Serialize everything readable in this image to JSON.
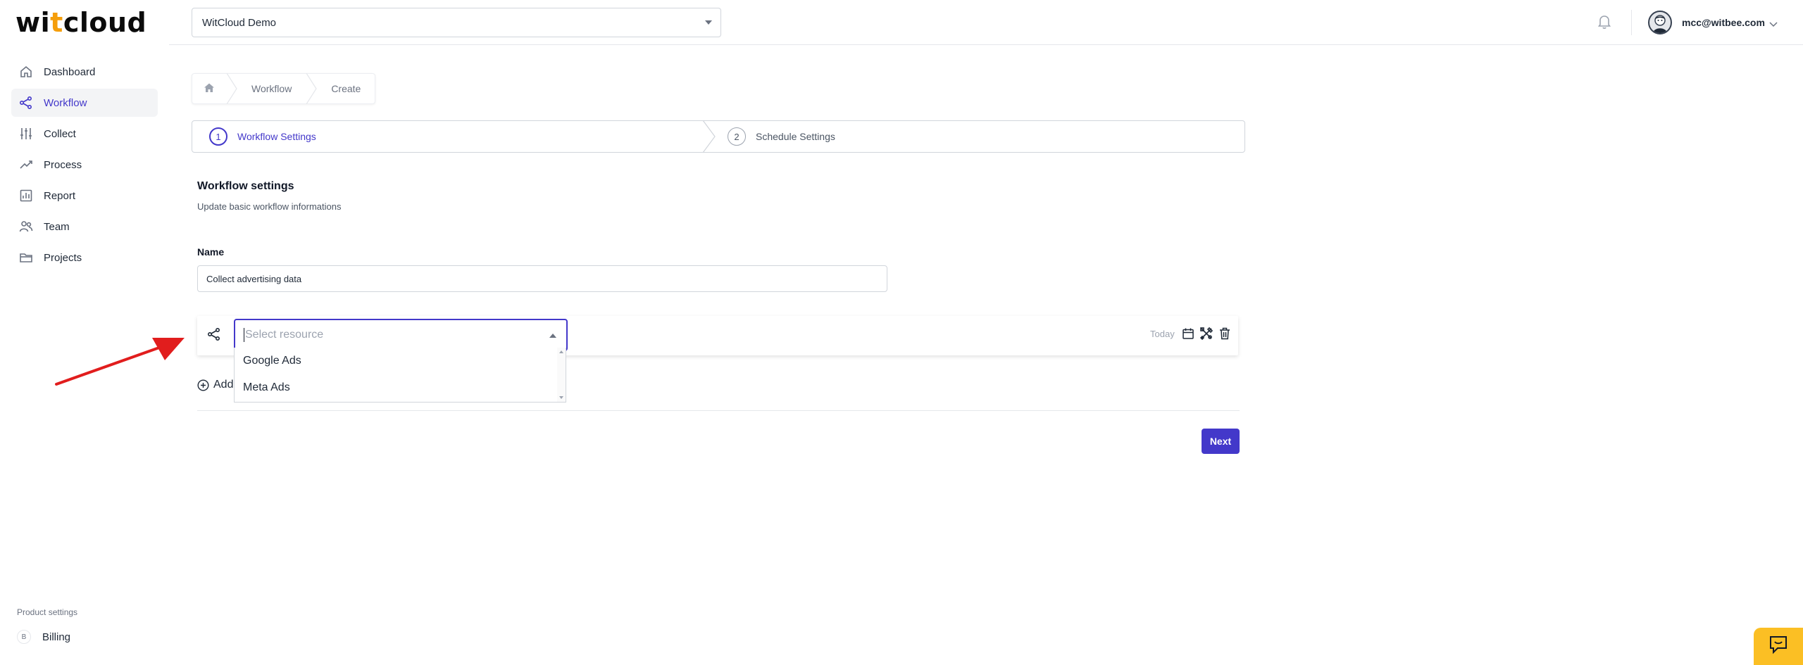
{
  "brand": {
    "logo_pre": "wi",
    "logo_accent": "t",
    "logo_post": "cloud",
    "accent_color": "#4338ca"
  },
  "sidebar": {
    "items": [
      {
        "label": "Dashboard",
        "icon": "home-icon"
      },
      {
        "label": "Workflow",
        "icon": "share-icon",
        "active": true
      },
      {
        "label": "Collect",
        "icon": "sliders-icon"
      },
      {
        "label": "Process",
        "icon": "trend-icon"
      },
      {
        "label": "Report",
        "icon": "chart-icon"
      },
      {
        "label": "Team",
        "icon": "users-icon"
      },
      {
        "label": "Projects",
        "icon": "folder-icon"
      }
    ],
    "product_settings_label": "Product settings",
    "billing_label": "Billing"
  },
  "topbar": {
    "org_value": "WitCloud Demo",
    "user_email": "mcc@witbee.com"
  },
  "breadcrumb": {
    "items": [
      "Workflow",
      "Create"
    ]
  },
  "steps": [
    {
      "num": "1",
      "label": "Workflow Settings",
      "active": true
    },
    {
      "num": "2",
      "label": "Schedule Settings",
      "active": false
    }
  ],
  "section": {
    "title": "Workflow settings",
    "subtitle": "Update basic workflow informations",
    "name_label": "Name",
    "name_value": "Collect advertising data"
  },
  "resource": {
    "placeholder": "Select resource",
    "date_label": "Today",
    "options": [
      "Google Ads",
      "Meta Ads"
    ]
  },
  "add_label": "Add",
  "next_label": "Next"
}
